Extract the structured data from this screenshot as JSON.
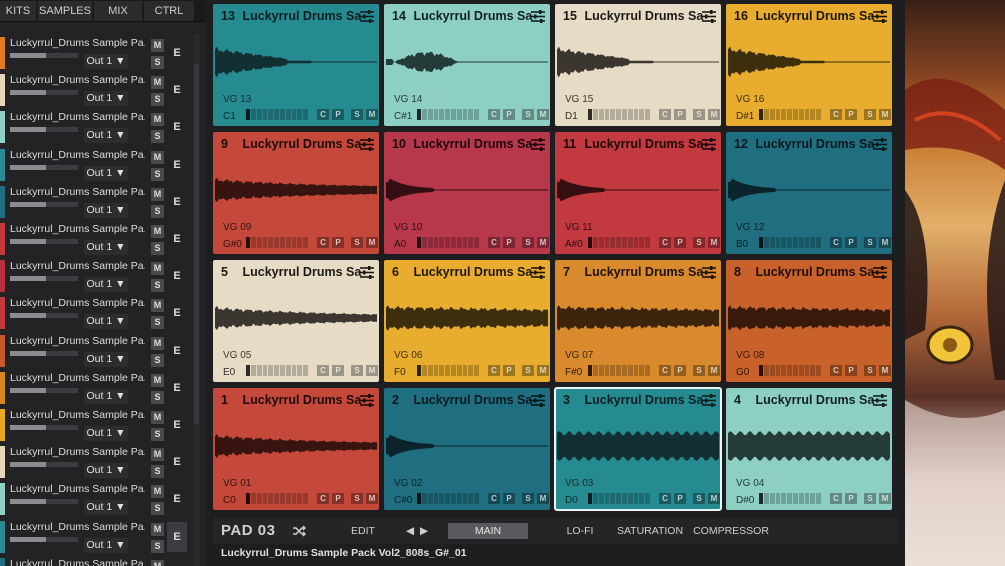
{
  "tabs": [
    {
      "label": "KITS",
      "active": false
    },
    {
      "label": "SAMPLES",
      "active": false
    },
    {
      "label": "MIX",
      "active": true
    },
    {
      "label": "CTRL",
      "active": false
    }
  ],
  "channels": [
    {
      "name": "Luckyrrul_Drums Sample Pa...",
      "output": "Out 1 ▼",
      "m": "M",
      "s": "S",
      "e": "E",
      "color": "#e07a1e",
      "active": false
    },
    {
      "name": "Luckyrrul_Drums Sample Pa...",
      "output": "Out 1 ▼",
      "m": "M",
      "s": "S",
      "e": "E",
      "color": "#e6d6b8",
      "active": false
    },
    {
      "name": "Luckyrrul_Drums Sample Pa...",
      "output": "Out 1 ▼",
      "m": "M",
      "s": "S",
      "e": "E",
      "color": "#8fd0c4",
      "active": false
    },
    {
      "name": "Luckyrrul_Drums Sample Pa...",
      "output": "Out 1 ▼",
      "m": "M",
      "s": "S",
      "e": "E",
      "color": "#2a8a96",
      "active": false
    },
    {
      "name": "Luckyrrul_Drums Sample Pa...",
      "output": "Out 1 ▼",
      "m": "M",
      "s": "S",
      "e": "E",
      "color": "#1e6e82",
      "active": false
    },
    {
      "name": "Luckyrrul_Drums Sample Pa...",
      "output": "Out 1 ▼",
      "m": "M",
      "s": "S",
      "e": "E",
      "color": "#c43a3a",
      "active": false
    },
    {
      "name": "Luckyrrul_Drums Sample Pa...",
      "output": "Out 1 ▼",
      "m": "M",
      "s": "S",
      "e": "E",
      "color": "#b83040",
      "active": false
    },
    {
      "name": "Luckyrrul_Drums Sample Pa...",
      "output": "Out 1 ▼",
      "m": "M",
      "s": "S",
      "e": "E",
      "color": "#c23a3a",
      "active": false
    },
    {
      "name": "Luckyrrul_Drums Sample Pa...",
      "output": "Out 1 ▼",
      "m": "M",
      "s": "S",
      "e": "E",
      "color": "#c85a2a",
      "active": false
    },
    {
      "name": "Luckyrrul_Drums Sample Pa...",
      "output": "Out 1 ▼",
      "m": "M",
      "s": "S",
      "e": "E",
      "color": "#d8881e",
      "active": false
    },
    {
      "name": "Luckyrrul_Drums Sample Pa...",
      "output": "Out 1 ▼",
      "m": "M",
      "s": "S",
      "e": "E",
      "color": "#e9a820",
      "active": false
    },
    {
      "name": "Luckyrrul_Drums Sample Pa...",
      "output": "Out 1 ▼",
      "m": "M",
      "s": "S",
      "e": "E",
      "color": "#e6d6b8",
      "active": false
    },
    {
      "name": "Luckyrrul_Drums Sample Pa...",
      "output": "Out 1 ▼",
      "m": "M",
      "s": "S",
      "e": "E",
      "color": "#8fd0c4",
      "active": false
    },
    {
      "name": "Luckyrrul_Drums Sample Pa...",
      "output": "Out 1 ▼",
      "m": "M",
      "s": "S",
      "e": "E",
      "color": "#2a8a96",
      "active": true
    },
    {
      "name": "Luckyrrul_Drums Sample Pa...",
      "output": "",
      "m": "M",
      "s": "",
      "e": "",
      "color": "#1e6e82",
      "active": false
    }
  ],
  "pads": [
    {
      "num": "13",
      "name": "Luckyrrul Drums Sa",
      "vg": "VG 13",
      "note": "C1",
      "bg": "#268a91",
      "fg": "#0f1f20",
      "wave": "short",
      "selected": false
    },
    {
      "num": "14",
      "name": "Luckyrrul Drums Sa",
      "vg": "VG 14",
      "note": "C#1",
      "bg": "#8ecfc3",
      "fg": "#12211f",
      "wave": "blip",
      "selected": false
    },
    {
      "num": "15",
      "name": "Luckyrrul Drums Sa",
      "vg": "VG 15",
      "note": "D1",
      "bg": "#e6dbc4",
      "fg": "#1c1a16",
      "wave": "short",
      "selected": false
    },
    {
      "num": "16",
      "name": "Luckyrrul Drums Sa",
      "vg": "VG 16",
      "note": "D#1",
      "bg": "#e8ad2e",
      "fg": "#1f1706",
      "wave": "short",
      "selected": false
    },
    {
      "num": "9",
      "name": "Luckyrrul Drums Sa",
      "vg": "VG 09",
      "note": "G#0",
      "bg": "#c4493b",
      "fg": "#1e0b08",
      "wave": "long",
      "selected": false
    },
    {
      "num": "10",
      "name": "Luckyrrul Drums Sa",
      "vg": "VG 10",
      "note": "A0",
      "bg": "#b6384a",
      "fg": "#1d070b",
      "wave": "kick",
      "selected": false
    },
    {
      "num": "11",
      "name": "Luckyrrul Drums Sa",
      "vg": "VG 11",
      "note": "A#0",
      "bg": "#c23a3f",
      "fg": "#1e0709",
      "wave": "kick",
      "selected": false
    },
    {
      "num": "12",
      "name": "Luckyrrul Drums Sa",
      "vg": "VG 12",
      "note": "B0",
      "bg": "#1f6f80",
      "fg": "#08181c",
      "wave": "kick",
      "selected": false
    },
    {
      "num": "5",
      "name": "Luckyrrul Drums Sa",
      "vg": "VG 05",
      "note": "E0",
      "bg": "#e6dbc4",
      "fg": "#1c1a16",
      "wave": "medium",
      "selected": false
    },
    {
      "num": "6",
      "name": "Luckyrrul Drums Sa",
      "vg": "VG 06",
      "note": "F0",
      "bg": "#e8ad2e",
      "fg": "#1f1706",
      "wave": "full",
      "selected": false
    },
    {
      "num": "7",
      "name": "Luckyrrul Drums Sa",
      "vg": "VG 07",
      "note": "F#0",
      "bg": "#d98a2c",
      "fg": "#1f1206",
      "wave": "full",
      "selected": false
    },
    {
      "num": "8",
      "name": "Luckyrrul Drums Sa",
      "vg": "VG 08",
      "note": "G0",
      "bg": "#c8622a",
      "fg": "#1f0e05",
      "wave": "full",
      "selected": false
    },
    {
      "num": "1",
      "name": "Luckyrrul Drums Sa",
      "vg": "VG 01",
      "note": "C0",
      "bg": "#c4493b",
      "fg": "#1e0b08",
      "wave": "medium",
      "selected": false
    },
    {
      "num": "2",
      "name": "Luckyrrul Drums Sa",
      "vg": "VG 02",
      "note": "C#0",
      "bg": "#1f6f80",
      "fg": "#08181c",
      "wave": "kick",
      "selected": false
    },
    {
      "num": "3",
      "name": "Luckyrrul Drums Sa",
      "vg": "VG 03",
      "note": "D0",
      "bg": "#268a91",
      "fg": "#0f1f20",
      "wave": "block",
      "selected": true
    },
    {
      "num": "4",
      "name": "Luckyrrul Drums Sa",
      "vg": "VG 04",
      "note": "D#0",
      "bg": "#8ecfc3",
      "fg": "#12211f",
      "wave": "block",
      "selected": false
    }
  ],
  "pad_buttons": [
    "C",
    "P",
    "S",
    "M"
  ],
  "bottom": {
    "pad_name": "PAD 03",
    "edit": "EDIT",
    "prev": "◀",
    "next": "▶",
    "main": "MAIN",
    "lofi": "LO-FI",
    "saturation": "SATURATION",
    "compressor": "COMPRESSOR",
    "active_tab": "main"
  },
  "sample_name": "Luckyrrul_Drums Sample Pack Vol2_808s_G#_01"
}
